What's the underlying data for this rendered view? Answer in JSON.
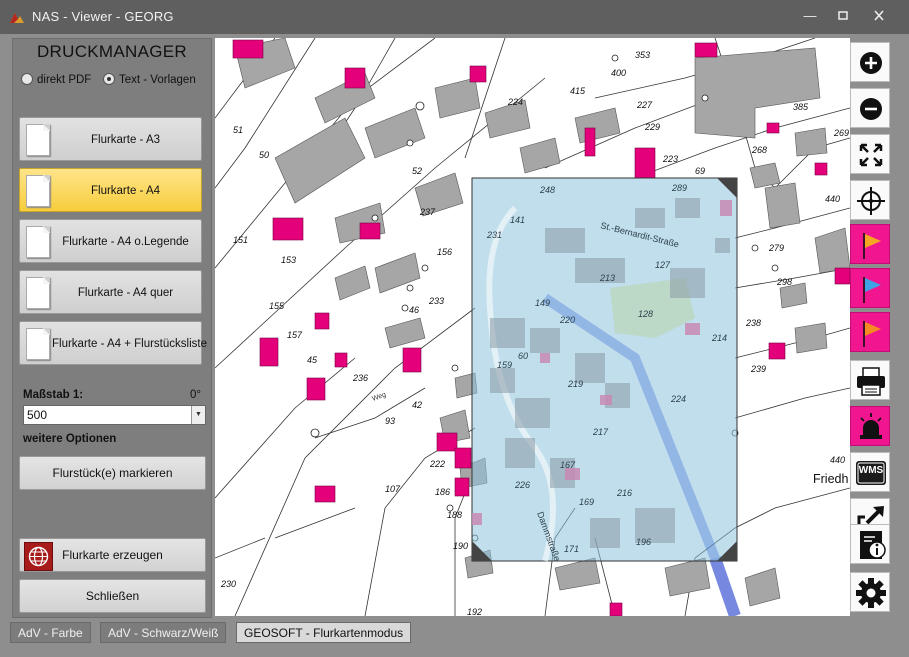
{
  "window": {
    "title": "NAS - Viewer -    GEORG",
    "controls": [
      "minimize",
      "maximize",
      "close"
    ]
  },
  "panel": {
    "title": "DRUCKMANAGER",
    "radio_pdf": "direkt PDF",
    "radio_templates": "Text - Vorlagen",
    "templates": [
      {
        "label": "Flurkarte - A3",
        "active": false
      },
      {
        "label": "Flurkarte - A4",
        "active": true
      },
      {
        "label": "Flurkarte - A4  o.Legende",
        "active": false
      },
      {
        "label": "Flurkarte - A4  quer",
        "active": false
      },
      {
        "label": "Flurkarte - A4 + Flurstücksliste",
        "active": false
      }
    ],
    "scale_label": "Maßstab 1:",
    "rotation": "0°",
    "scale_value": "500",
    "options_label": "weitere Optionen",
    "mark_button": "Flurstück(e) markieren",
    "create_button": "Flurkarte erzeugen",
    "close_button": "Schließen"
  },
  "map": {
    "labels": [
      "51",
      "50",
      "151",
      "153",
      "155",
      "157",
      "45",
      "236",
      "52",
      "237",
      "156",
      "233",
      "46",
      "42",
      "93",
      "222",
      "186",
      "188",
      "190",
      "107",
      "230",
      "192",
      "224",
      "415",
      "400",
      "353",
      "227",
      "229",
      "223",
      "69",
      "385",
      "268",
      "269",
      "440",
      "279",
      "298",
      "238",
      "239",
      "52",
      "248",
      "141",
      "231",
      "220",
      "159",
      "149",
      "60",
      "219",
      "217",
      "167",
      "169",
      "216",
      "196",
      "171",
      "213",
      "127",
      "128",
      "214",
      "224",
      "226",
      "Friedh"
    ],
    "street_labels": [
      "St.-Bernardit-Straße",
      "Dammstraße",
      "Weg"
    ],
    "friedh_label": "Friedh",
    "n440": "440"
  },
  "toolbar": {
    "tools": [
      "zoom-in",
      "zoom-out",
      "full-extent",
      "crosshair",
      "flag-orange",
      "flag-blue",
      "flag-orange-2",
      "print",
      "home-alarm",
      "wms",
      "export",
      "info",
      "settings"
    ],
    "wms_label": "WMS"
  },
  "tabs": [
    {
      "label": "AdV - Farbe",
      "active": false
    },
    {
      "label": "AdV - Schwarz/Weiß",
      "active": false
    },
    {
      "label": "GEOSOFT - Flurkartenmodus",
      "active": true
    }
  ],
  "colors": {
    "parcel_pink": "#e3007a",
    "building_gray": "#a6a6a6",
    "selection_blue": "#a9d1e6",
    "active_template": "#f7cd3c"
  }
}
